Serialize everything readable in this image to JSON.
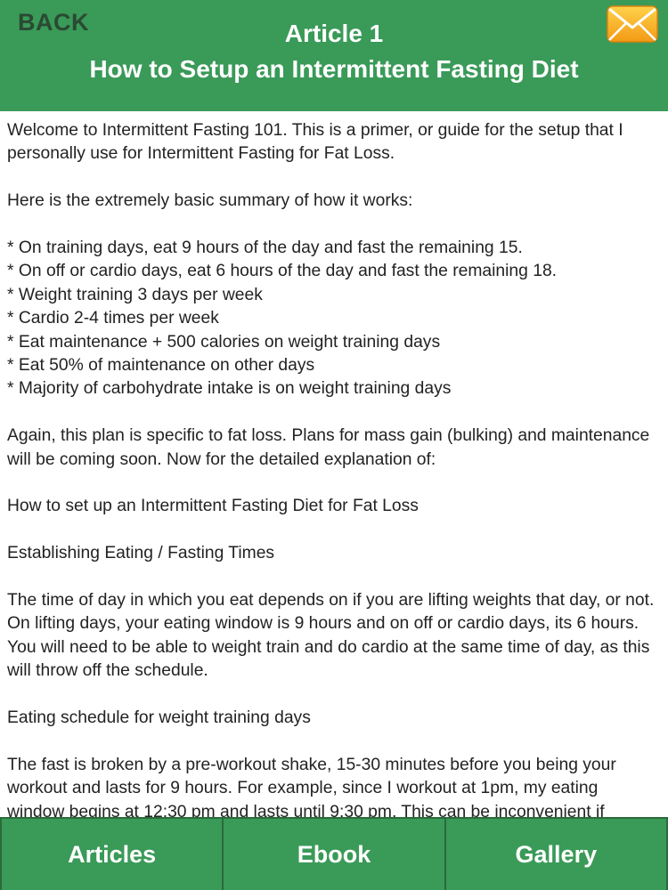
{
  "header": {
    "back_label": "BACK",
    "title_line1": "Article 1",
    "title_line2": "How to Setup an Intermittent Fasting Diet",
    "mail_icon": "envelope-icon"
  },
  "article": {
    "paragraphs": [
      "Welcome to Intermittent Fasting 101. This is a primer, or guide for the setup that I personally use for Intermittent Fasting for Fat Loss.",
      "Here is the extremely basic summary of how it works:",
      "* On training days, eat 9 hours of the day and fast the remaining 15.\n* On off or cardio days, eat 6 hours of the day and fast the remaining 18.\n* Weight training 3 days per week\n* Cardio 2-4 times per week\n* Eat maintenance + 500 calories on weight training days\n* Eat 50% of maintenance on other days\n* Majority of carbohydrate intake is on weight training days",
      "Again, this plan is specific to fat loss. Plans for mass gain (bulking) and maintenance will be coming soon. Now for the detailed explanation of:",
      "How to set up an Intermittent Fasting Diet for Fat Loss",
      "Establishing Eating / Fasting Times",
      "The time of day in which you eat depends on if you are lifting weights that day, or not. On lifting days, your eating window is 9 hours and on off or cardio days, its 6 hours. You will need to be able to weight train and do cardio at the same time of day, as this will throw off the schedule.",
      "Eating schedule for weight training days",
      "The fast is broken by a pre-workout shake, 15-30 minutes before you being your workout and lasts for 9 hours. For example, since I workout at 1pm, my eating window begins at 12:30 pm and lasts until 9:30 pm. This can be inconvenient if"
    ]
  },
  "footer": {
    "tabs": [
      "Articles",
      "Ebook",
      "Gallery"
    ]
  },
  "colors": {
    "accent": "#3a9a58",
    "back_text": "#2a4a33",
    "divider": "#2a6b3c",
    "envelope": "#f5a623"
  }
}
